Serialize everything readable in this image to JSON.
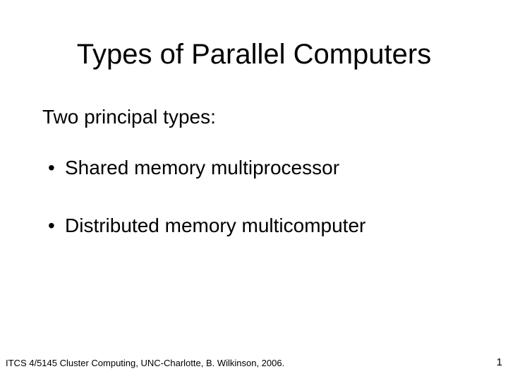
{
  "slide": {
    "title": "Types of Parallel Computers",
    "subtitle": "Two principal types:",
    "bullets": [
      "Shared memory multiprocessor",
      "Distributed memory multicomputer"
    ]
  },
  "footer": {
    "left": "ITCS 4/5145 Cluster Computing, UNC-Charlotte, B. Wilkinson, 2006.",
    "page_number": "1"
  }
}
